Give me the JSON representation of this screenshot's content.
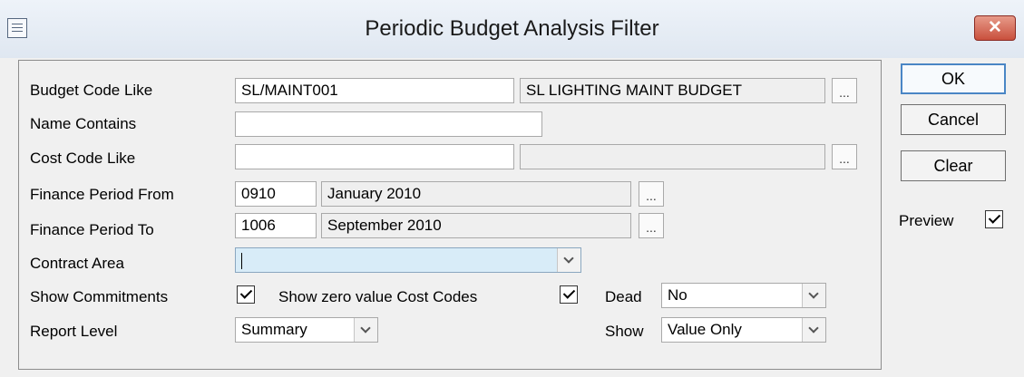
{
  "window": {
    "title": "Periodic Budget Analysis Filter",
    "close_glyph": "✕"
  },
  "form": {
    "budget_code": {
      "label": "Budget Code Like",
      "value": "SL/MAINT001",
      "description": "SL LIGHTING MAINT BUDGET",
      "lookup": "..."
    },
    "name_contains": {
      "label": "Name Contains",
      "value": ""
    },
    "cost_code": {
      "label": "Cost Code Like",
      "value": "",
      "description": "",
      "lookup": "..."
    },
    "finance_from": {
      "label": "Finance Period From",
      "value": "0910",
      "description": "January 2010",
      "lookup": "..."
    },
    "finance_to": {
      "label": "Finance Period To",
      "value": "1006",
      "description": "September 2010",
      "lookup": "..."
    },
    "contract_area": {
      "label": "Contract Area",
      "value": ""
    },
    "show_commitments": {
      "label": "Show Commitments",
      "checked": true
    },
    "show_zero_value": {
      "label": "Show zero value Cost Codes",
      "checked": true
    },
    "dead": {
      "label": "Dead",
      "value": "No"
    },
    "report_level": {
      "label": "Report Level",
      "value": "Summary"
    },
    "show": {
      "label": "Show",
      "value": "Value Only"
    }
  },
  "buttons": {
    "ok": "OK",
    "cancel": "Cancel",
    "clear": "Clear"
  },
  "preview": {
    "label": "Preview",
    "checked": true
  },
  "icons": {
    "window": "window-menu-icon",
    "close": "close-icon",
    "dropdown": "chevron-down-icon",
    "checkmark": "checkmark-icon"
  },
  "colors": {
    "active_field": "#d8ecf8",
    "close_button": "#c9503d",
    "default_button_border": "#4a86c5"
  }
}
